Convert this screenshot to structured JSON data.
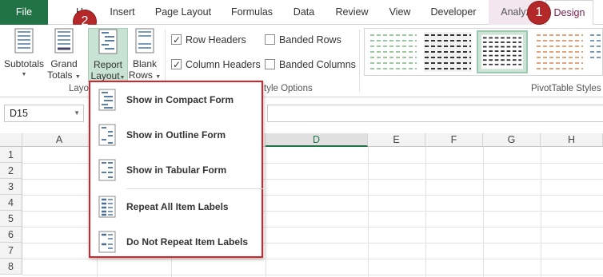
{
  "tabs": [
    {
      "label": "File"
    },
    {
      "label": "Ho"
    },
    {
      "label": "Insert"
    },
    {
      "label": "Page Layout"
    },
    {
      "label": "Formulas"
    },
    {
      "label": "Data"
    },
    {
      "label": "Review"
    },
    {
      "label": "View"
    },
    {
      "label": "Developer"
    },
    {
      "label": "Analyz"
    },
    {
      "label": "Design"
    }
  ],
  "badges": {
    "one": "1",
    "two": "2"
  },
  "ribbon": {
    "subtotals": "Subtotals",
    "grand_totals_1": "Grand",
    "grand_totals_2": "Totals",
    "report_layout_1": "Report",
    "report_layout_2": "Layout",
    "blank_rows_1": "Blank",
    "blank_rows_2": "Rows",
    "layout_group": "Layo",
    "style_options_group": "tyle Options",
    "row_headers": "Row Headers",
    "column_headers": "Column Headers",
    "banded_rows": "Banded Rows",
    "banded_columns": "Banded Columns",
    "pivot_styles_group": "PivotTable Styles",
    "checked": {
      "row_headers": true,
      "column_headers": true,
      "banded_rows": false,
      "banded_columns": false
    }
  },
  "formula_bar": {
    "name_box": "D15"
  },
  "columns": [
    "A",
    "B",
    "C",
    "D",
    "E",
    "F",
    "G",
    "H"
  ],
  "selected_column": "D",
  "rows": [
    "1",
    "2",
    "3",
    "4",
    "5",
    "6",
    "7",
    "8"
  ],
  "menu": {
    "items": [
      {
        "label": "Show in Compact Form",
        "icon": "compact-form-icon"
      },
      {
        "label": "Show in Outline Form",
        "icon": "outline-form-icon"
      },
      {
        "label": "Show in Tabular Form",
        "icon": "tabular-form-icon"
      },
      {
        "label": "Repeat All Item Labels",
        "icon": "repeat-labels-icon"
      },
      {
        "label": "Do Not Repeat Item Labels",
        "icon": "no-repeat-labels-icon"
      }
    ]
  },
  "colors": {
    "excel_green": "#217346",
    "highlight": "#d9232a",
    "design_tab_text": "#7a1f50"
  }
}
